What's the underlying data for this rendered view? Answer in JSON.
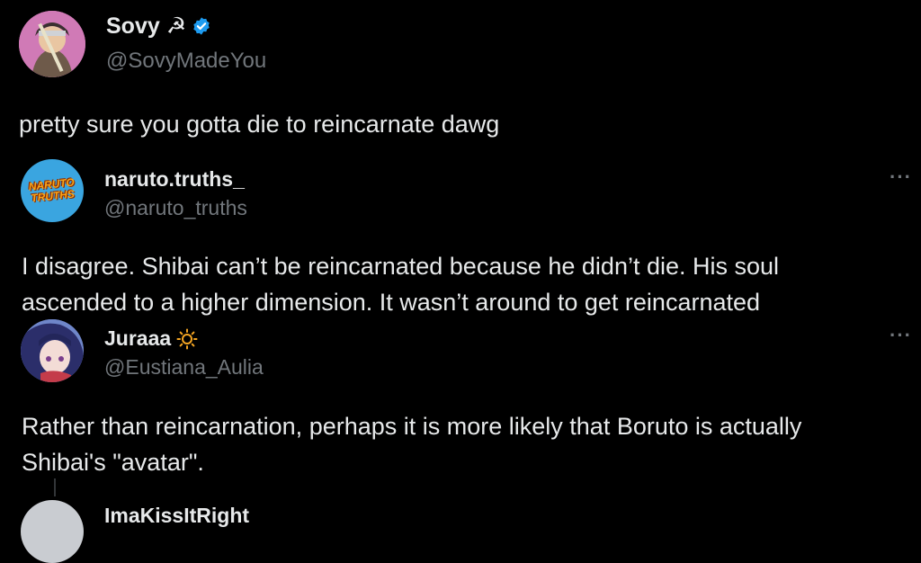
{
  "posts": [
    {
      "name": "Sovy ☭",
      "handle": "@SovyMadeYou",
      "text": "pretty sure you gotta die to reincarnate dawg",
      "verified": true
    },
    {
      "name": "naruto.truths_",
      "handle": "@naruto_truths",
      "avatar_text": "NARUTO TRUTHS",
      "text_line1": "I disagree. Shibai can’t be reincarnated because he didn’t die. His soul",
      "text_line2": "ascended to a higher dimension. It wasn’t around to get reincarnated"
    },
    {
      "name": "Juraaa",
      "handle": "@Eustiana_Aulia",
      "text_line1": "Rather than reincarnation, perhaps it is more likely that Boruto is actually",
      "text_line2": "Shibai's \"avatar\"."
    },
    {
      "name": "ImaKissItRight"
    }
  ],
  "more_icon": "···",
  "colors": {
    "verified": "#1d9bf0",
    "sun": "#f5a623",
    "avatar2": "#3aa5e0"
  }
}
